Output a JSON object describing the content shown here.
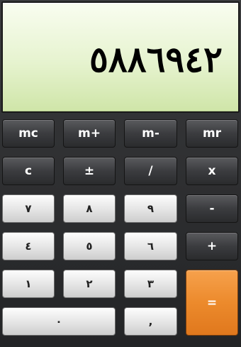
{
  "display": {
    "value": "٥٨٨٦٩٤٢"
  },
  "memory": {
    "mc": "mc",
    "mplus": "m+",
    "mminus": "m-",
    "mr": "mr"
  },
  "ops": {
    "clear": "c",
    "sign": "±",
    "divide": "/",
    "multiply": "x",
    "minus": "-",
    "plus": "+",
    "equals": "="
  },
  "digits": {
    "seven": "٧",
    "eight": "٨",
    "nine": "٩",
    "four": "٤",
    "five": "٥",
    "six": "٦",
    "one": "١",
    "two": "٢",
    "three": "٣",
    "zero": "٠",
    "decimal": ","
  }
}
